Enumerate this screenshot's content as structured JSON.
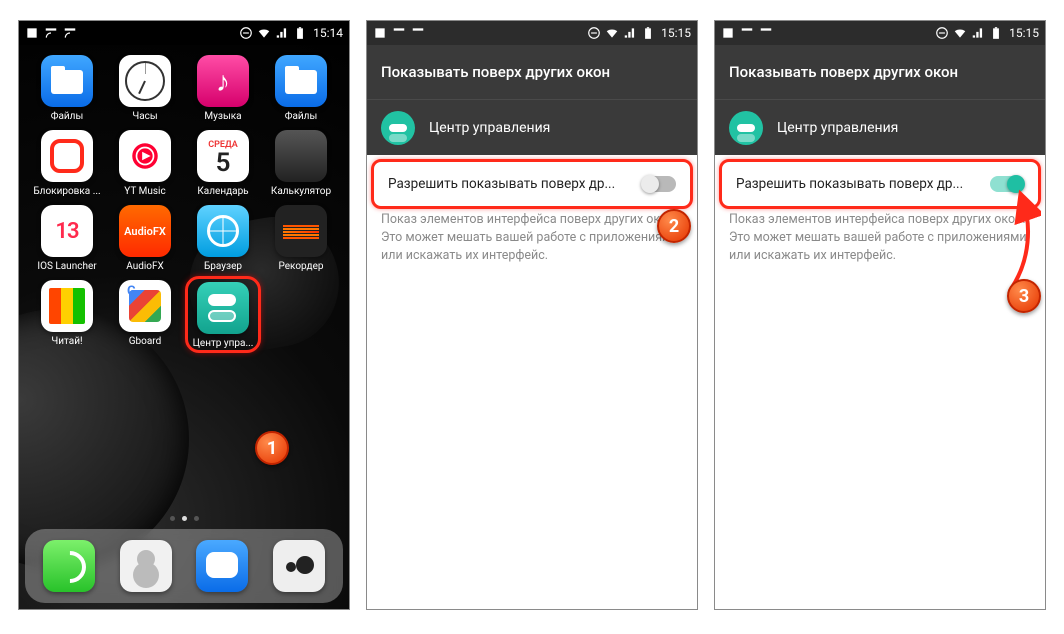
{
  "status": {
    "time1": "15:14",
    "time2": "15:15",
    "time3": "15:15"
  },
  "home": {
    "apps": [
      {
        "label": "Файлы",
        "icon": "folder"
      },
      {
        "label": "Часы",
        "icon": "clock"
      },
      {
        "label": "Музыка",
        "icon": "music"
      },
      {
        "label": "Файлы",
        "icon": "folder"
      },
      {
        "label": "Блокировка ...",
        "icon": "redrec"
      },
      {
        "label": "YT Music",
        "icon": "yt"
      },
      {
        "label": "Календарь",
        "icon": "cal",
        "dow": "СРЕДА",
        "day": "5"
      },
      {
        "label": "Калькулятор",
        "icon": "calc"
      },
      {
        "label": "IOS Launcher",
        "icon": "i13",
        "txt": "13"
      },
      {
        "label": "AudioFX",
        "icon": "afx",
        "txt": "AudioFX"
      },
      {
        "label": "Браузер",
        "icon": "browser"
      },
      {
        "label": "Рекордер",
        "icon": "rec"
      },
      {
        "label": "Читай!",
        "icon": "read"
      },
      {
        "label": "Gboard",
        "icon": "gboard"
      },
      {
        "label": "Центр упра...",
        "icon": "cc",
        "highlight": true
      }
    ],
    "dock": [
      {
        "name": "phone",
        "icon": "phone"
      },
      {
        "name": "contacts",
        "icon": "contacts"
      },
      {
        "name": "messages",
        "icon": "msg"
      },
      {
        "name": "camera",
        "icon": "cam"
      }
    ]
  },
  "settings": {
    "title": "Показывать поверх других окон",
    "app_name": "Центр управления",
    "permission_label": "Разрешить показывать поверх др...",
    "description": "Показ элементов интерфейса поверх других окон. Это может мешать вашей работе с приложениями или искажать их интерфейс."
  },
  "steps": {
    "s1": "1",
    "s2": "2",
    "s3": "3"
  }
}
